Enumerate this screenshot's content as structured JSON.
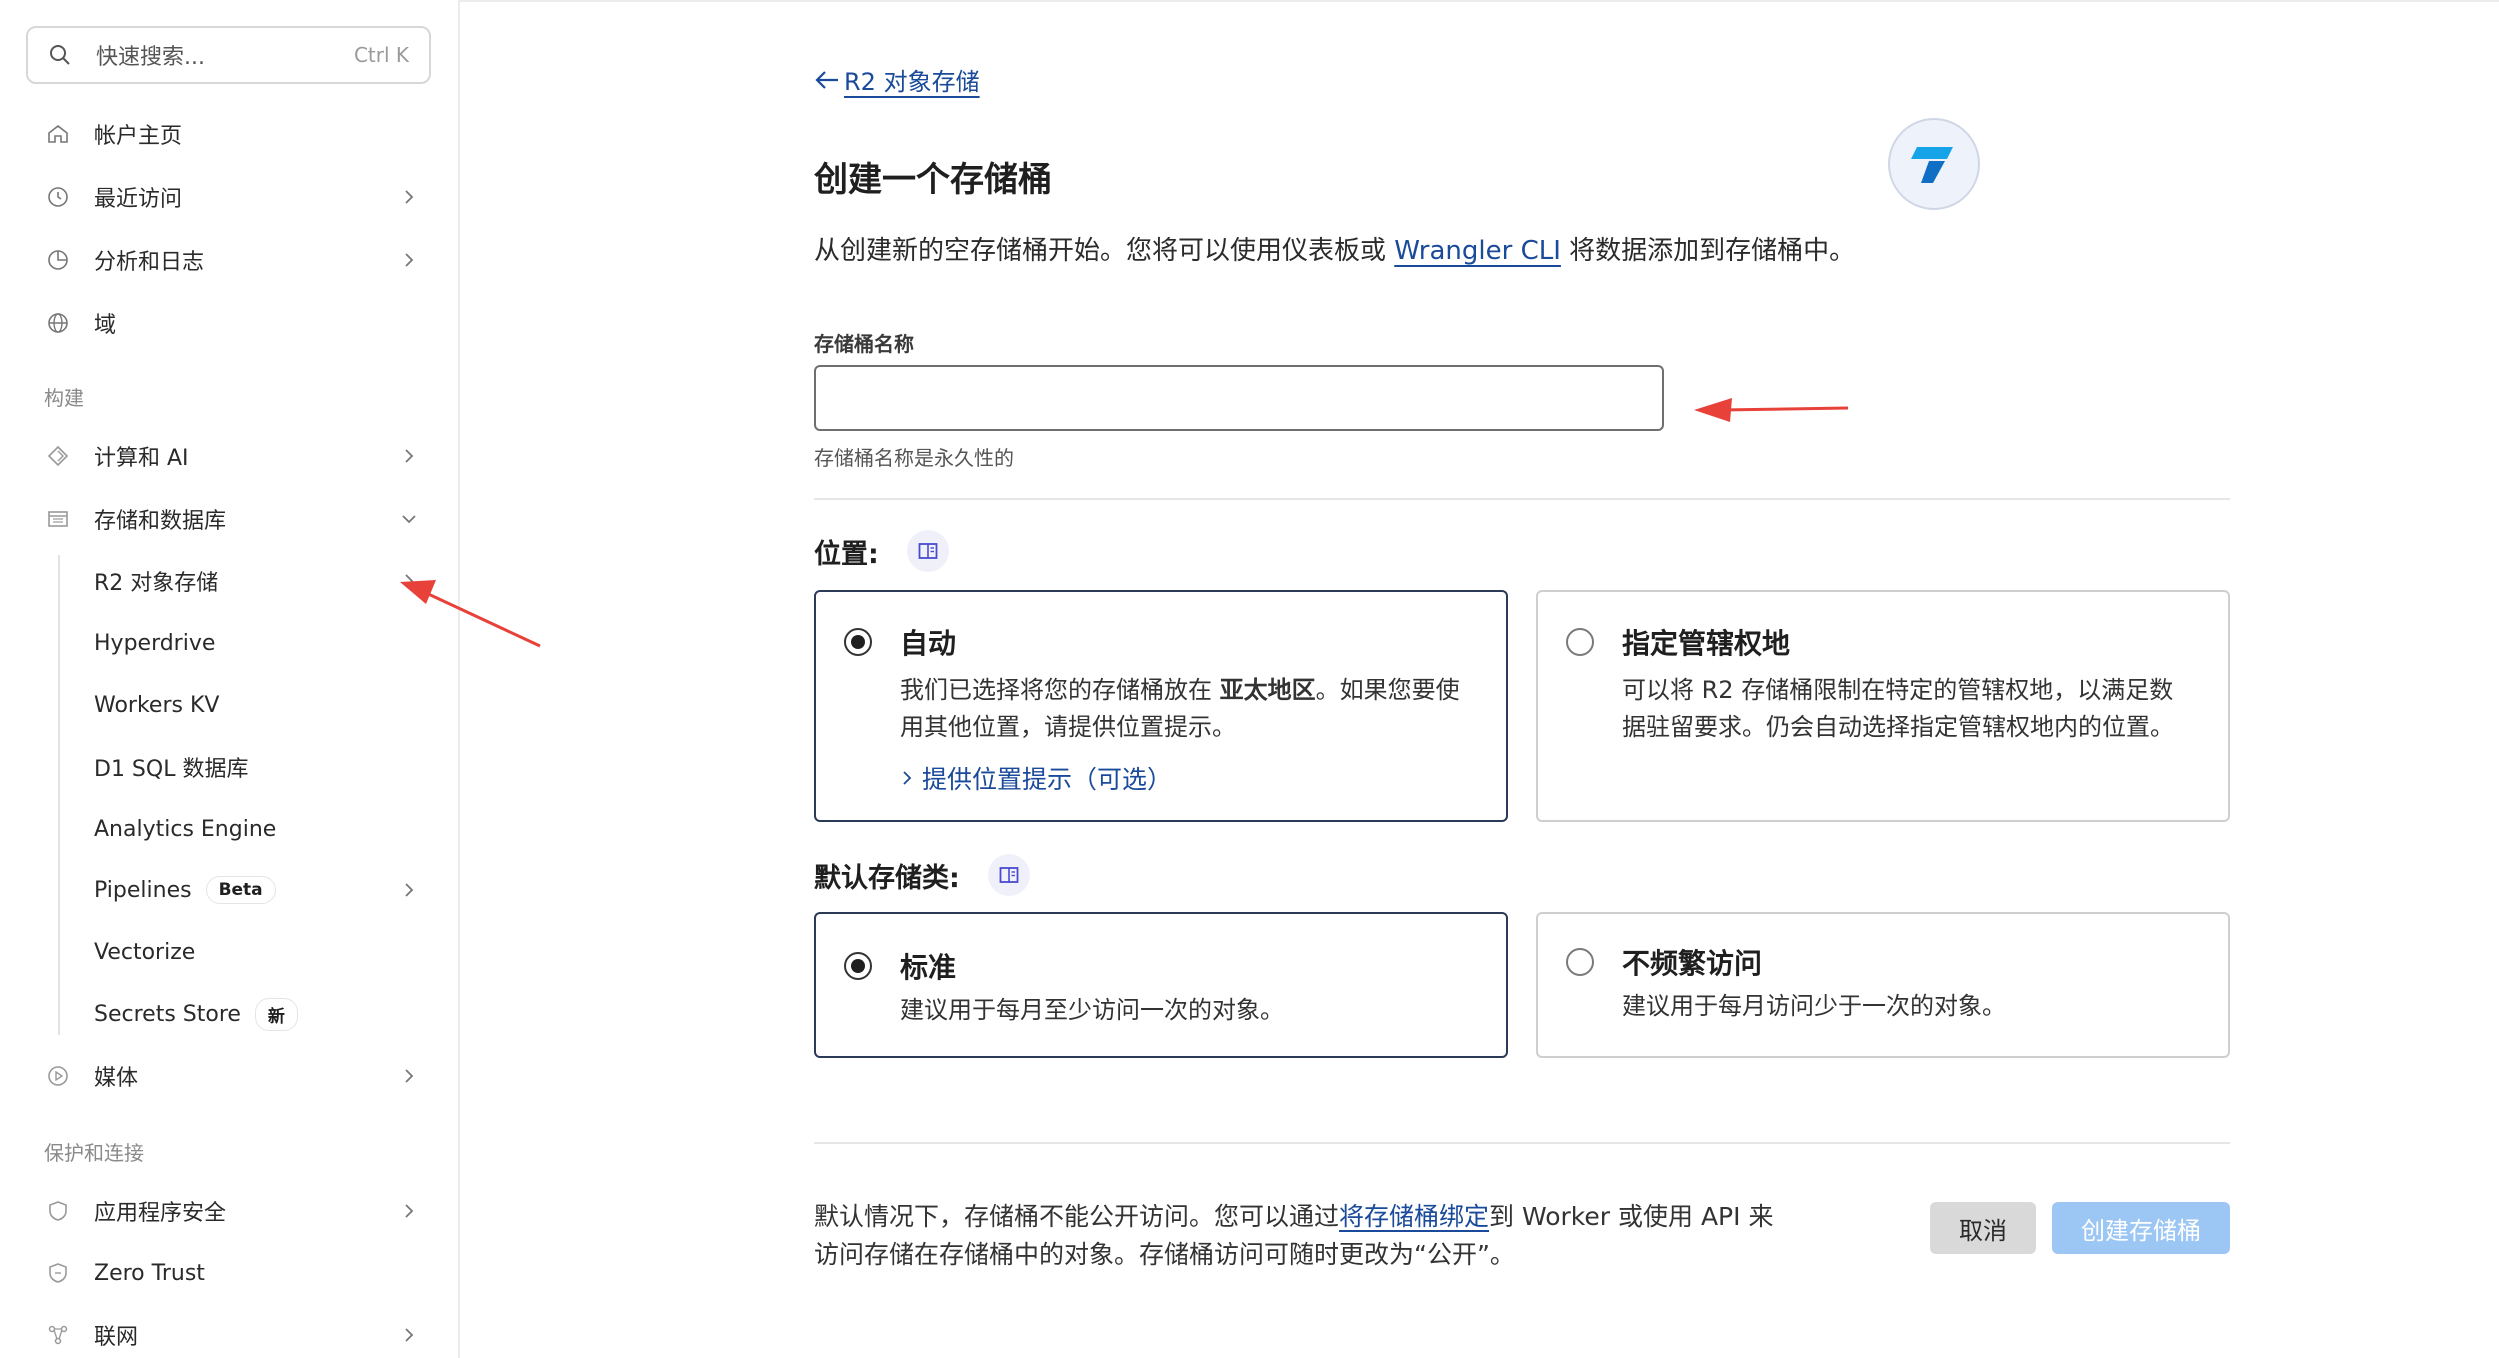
{
  "sidebar": {
    "search": {
      "placeholder": "快速搜索...",
      "shortcut": "Ctrl K"
    },
    "top_items": [
      {
        "label": "帐户主页",
        "icon": "home-icon"
      },
      {
        "label": "最近访问",
        "icon": "clock-icon"
      },
      {
        "label": "分析和日志",
        "icon": "chart-icon"
      },
      {
        "label": "域",
        "icon": "globe-icon"
      }
    ],
    "sections": {
      "build": "构建",
      "protect": "保护和连接"
    },
    "build_items": [
      {
        "label": "计算和 AI",
        "icon": "compute-icon"
      },
      {
        "label": "存储和数据库",
        "icon": "database-icon"
      }
    ],
    "storage_sub_items": [
      {
        "label": "R2 对象存储"
      },
      {
        "label": "Hyperdrive"
      },
      {
        "label": "Workers KV"
      },
      {
        "label": "D1 SQL 数据库"
      },
      {
        "label": "Analytics Engine"
      },
      {
        "label": "Pipelines",
        "badge": "Beta"
      },
      {
        "label": "Vectorize"
      },
      {
        "label": "Secrets Store",
        "badge": "新"
      }
    ],
    "media_item": {
      "label": "媒体",
      "icon": "media-icon"
    },
    "protect_items": [
      {
        "label": "应用程序安全",
        "icon": "shield-icon"
      },
      {
        "label": "Zero Trust",
        "icon": "zero-trust-icon"
      },
      {
        "label": "联网",
        "icon": "network-icon"
      }
    ]
  },
  "main": {
    "back_link": "R2 对象存储",
    "title": "创建一个存储桶",
    "intro_before": "从创建新的空存储桶开始。您将可以使用仪表板或 ",
    "intro_link": "Wrangler CLI",
    "intro_after": " 将数据添加到存储桶中。",
    "bucket_name_label": "存储桶名称",
    "bucket_name_value": "",
    "bucket_name_help": "存储桶名称是永久性的",
    "location": {
      "heading": "位置:",
      "options": [
        {
          "title": "自动",
          "desc_before": "我们已选择将您的存储桶放在 ",
          "desc_bold": "亚太地区",
          "desc_after": "。如果您要使",
          "desc_line2": "用其他位置，请提供位置提示。",
          "hint_link": "提供位置提示（可选）",
          "selected": true
        },
        {
          "title": "指定管辖权地",
          "desc_line1": "可以将 R2 存储桶限制在特定的管辖权地，以满足数",
          "desc_line2": "据驻留要求。仍会自动选择指定管辖权地内的位置。",
          "selected": false
        }
      ]
    },
    "storage_class": {
      "heading": "默认存储类:",
      "options": [
        {
          "title": "标准",
          "desc": "建议用于每月至少访问一次的对象。",
          "selected": true
        },
        {
          "title": "不频繁访问",
          "desc": "建议用于每月访问少于一次的对象。",
          "selected": false
        }
      ]
    },
    "footer": {
      "text_before": "默认情况下，存储桶不能公开访问。您可以通过",
      "text_link": "将存储桶绑定",
      "text_after": "到 Worker 或使用 API 来",
      "text_line2": "访问存储在存储桶中的对象。存储桶访问可随时更改为“公开”。",
      "cancel_label": "取消",
      "create_label": "创建存储桶"
    }
  },
  "colors": {
    "link": "#1a4a9a",
    "annotation_arrow": "#e8413a",
    "create_button": "#9cc6f3",
    "cancel_button": "#d9d9d9",
    "selected_border": "#2b3a57"
  }
}
